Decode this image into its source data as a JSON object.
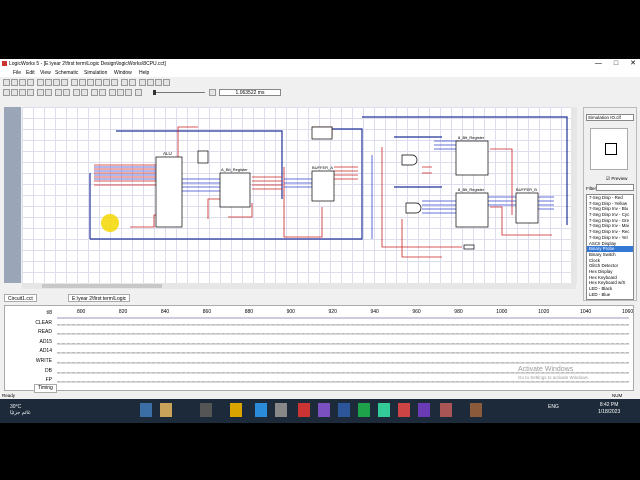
{
  "window": {
    "title": "LogicWorks 5 - [E:\\year 2\\first term\\Logic Design\\logicWorks\\8CPU.cct]",
    "controls": [
      "—",
      "□",
      "✕"
    ]
  },
  "menu": [
    "File",
    "Edit",
    "View",
    "Schematic",
    "Simulation",
    "Window",
    "Help"
  ],
  "toolbar": {
    "time_display": "1.063522 ms"
  },
  "schematic": {
    "labels": {
      "alu": "ALU",
      "reg_a": "A_Bit_Register",
      "buffer_a": "BUFFER_A",
      "reg_b": "8_Bit_Register",
      "reg_c": "8_Bit_Register",
      "buffer_b": "BUFFER_B"
    }
  },
  "doc_tabs": [
    "Circuit1.cct",
    "E:\\year 2\\first term\\Logic"
  ],
  "parts_panel": {
    "library": "Simulation IO.clf",
    "preview_label": "Preview",
    "filter_label": "Filter:",
    "filter_value": "",
    "items": [
      "7-Seg Disp - Red",
      "7-Seg Disp - Yellow",
      "7-Seg Disp Inv - Blu",
      "7-Seg Disp Inv - Cyc",
      "7-Seg Disp Inv - Gre",
      "7-Seg Disp Inv - Mai",
      "7-Seg Disp Inv - Rec",
      "7-Seg Disp Inv - Yel",
      "ASCII Display",
      "Binary Probe",
      "Binary Switch",
      "Clock",
      "Glitch Detector",
      "Hex Display",
      "Hex Keyboard",
      "Hex Keyboard w/S",
      "LED - Black",
      "LED - Blue"
    ],
    "selected": "Binary Probe"
  },
  "timing": {
    "ticks": [
      "800",
      "820",
      "840",
      "860",
      "880",
      "900",
      "920",
      "940",
      "960",
      "980",
      "1000",
      "1020",
      "1040",
      "1060"
    ],
    "signals": [
      "t/8",
      "CLEAR",
      "READ",
      "AD15",
      "AD14",
      "WRITE",
      "DB",
      "FP"
    ],
    "tab_label": "Timing"
  },
  "watermark": {
    "line1": "Activate Windows",
    "line2": "Go to Settings to activate Windows."
  },
  "status": {
    "left": "Ready",
    "right": "NUM"
  },
  "taskbar": {
    "weather_temp": "30°C",
    "weather_desc": "غائم جزئيًا",
    "lang": "ENG",
    "time": "8:42 PM",
    "date": "1/18/2023"
  },
  "colors": {
    "accent_blue": "#1f3fbf",
    "wire_red": "#cc2222",
    "wire_blue": "#223399",
    "list_select": "#3478d4",
    "cursor_highlight": "#f5d700"
  }
}
